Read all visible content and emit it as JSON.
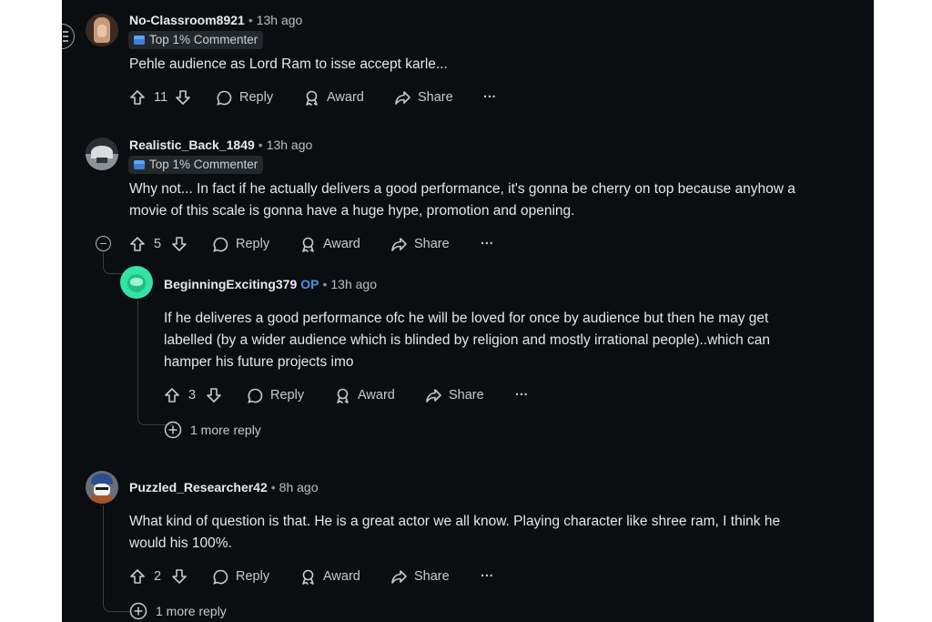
{
  "comments": [
    {
      "author": "No-Classroom8921",
      "time": "13h ago",
      "badge": "Top 1% Commenter",
      "text": "Pehle audience as Lord Ram to isse accept karle...",
      "votes": "11",
      "reply": "Reply",
      "award": "Award",
      "share": "Share",
      "menu": "···"
    },
    {
      "author": "Realistic_Back_1849",
      "time": "13h ago",
      "badge": "Top 1% Commenter",
      "text_line1": "Why not... In fact if he actually delivers a good performance, it's gonna be cherry on top because anyhow a",
      "text_line2": "movie of this scale is gonna have a huge hype, promotion and opening.",
      "votes": "5",
      "reply": "Reply",
      "award": "Award",
      "share": "Share",
      "menu": "···"
    },
    {
      "author": "BeginningExciting379",
      "op_label": "OP",
      "time": "13h ago",
      "text_line1": "If he deliveres a good performance ofc he will be loved for once by audience but then he may get",
      "text_line2": "labelled (by a wider audience which is blinded by religion and mostly irrational people)..which can",
      "text_line3": "hamper his future projects imo",
      "votes": "3",
      "reply": "Reply",
      "award": "Award",
      "share": "Share",
      "menu": "···",
      "more_replies": "1 more reply"
    },
    {
      "author": "Puzzled_Researcher42",
      "time": "8h ago",
      "text_line1": "What kind of question is that. He is a great actor we all know. Playing character like shree ram, I think he",
      "text_line2": "would his 100%.",
      "votes": "2",
      "reply": "Reply",
      "award": "Award",
      "share": "Share",
      "menu": "···",
      "more_replies": "1 more reply"
    }
  ],
  "separator": "•",
  "colors": {
    "background": "#0b0e11",
    "op": "#4f8fe6",
    "text": "#e3e7ea",
    "muted": "#b7c0c6"
  }
}
